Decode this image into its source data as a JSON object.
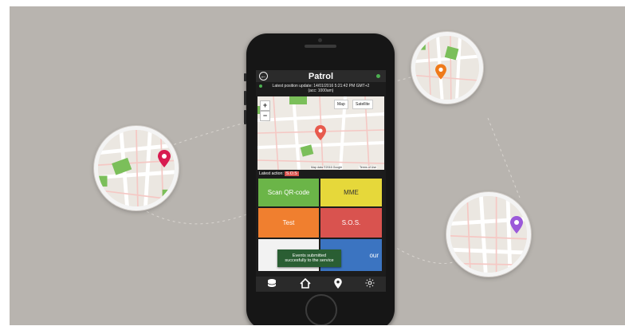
{
  "app": {
    "title": "Patrol",
    "update_line1": "Latest position update: 14/01/2016 5:21:42 PM GMT+2",
    "update_line2": "(acc: 1000am)"
  },
  "map": {
    "zoom_in": "+",
    "zoom_out": "−",
    "type_map": "Map",
    "type_satellite": "Satellite",
    "attribution": "Map data ©2016 Google",
    "terms": "Terms of Use"
  },
  "status": {
    "last_action_label": "Latest action:",
    "last_action_value": "S.O.S"
  },
  "tiles": [
    {
      "label": "Scan QR-code",
      "color": "#6bb548"
    },
    {
      "label": "MME",
      "color": "#e6d83a"
    },
    {
      "label": "Test",
      "color": "#f07f2f"
    },
    {
      "label": "S.O.S.",
      "color": "#d9534f"
    },
    {
      "label": "",
      "color": "#f2f2f2"
    },
    {
      "label": "our",
      "color": "#3b74c1"
    }
  ],
  "toast": {
    "line1": "Events submitted",
    "line2": "succesfully to the service"
  },
  "nav": {
    "db_icon": "database-icon",
    "home_icon": "home-icon",
    "pin_icon": "map-pin-icon",
    "settings_icon": "sun-settings-icon"
  },
  "pins": {
    "left": "#d81b4f",
    "top_right": "#ef7a1a",
    "bottom_right": "#9b59d9",
    "center": "#e75a4d"
  }
}
